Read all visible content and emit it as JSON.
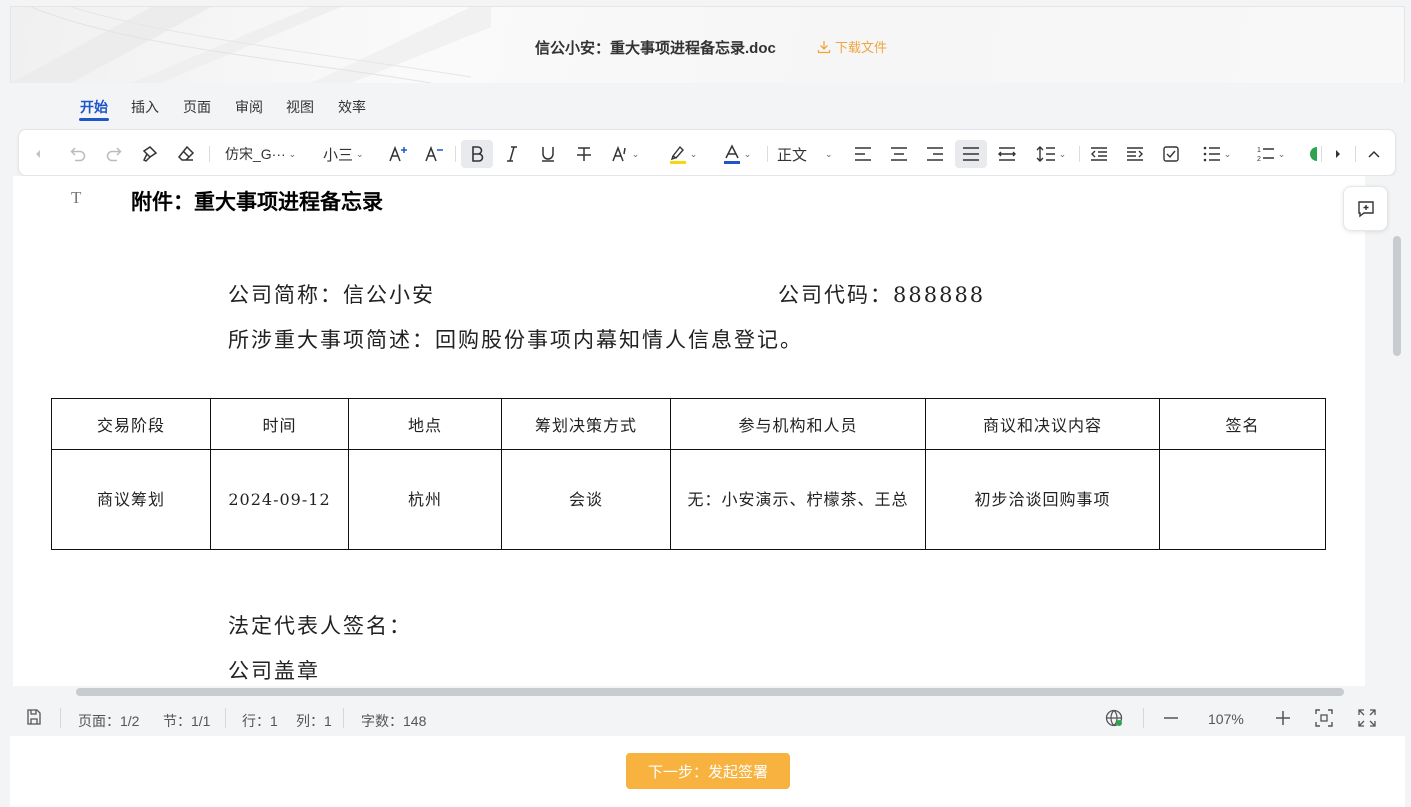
{
  "header": {
    "doc_title": "信公小安：重大事项进程备忘录.doc",
    "download_label": "下载文件"
  },
  "menu": {
    "tabs": [
      {
        "label": "开始",
        "active": true
      },
      {
        "label": "插入",
        "active": false
      },
      {
        "label": "页面",
        "active": false
      },
      {
        "label": "审阅",
        "active": false
      },
      {
        "label": "视图",
        "active": false
      },
      {
        "label": "效率",
        "active": false
      }
    ]
  },
  "toolbar": {
    "font_family": "仿宋_G···",
    "font_size": "小三",
    "style": "正文",
    "icons": [
      "prev-icon",
      "undo-icon",
      "redo-icon",
      "format-painter-icon",
      "eraser-icon",
      "font-grow-icon",
      "font-shrink-icon",
      "bold-icon",
      "italic-icon",
      "underline-icon",
      "strikethrough-icon",
      "text-effect-icon",
      "highlight-icon",
      "font-color-icon",
      "align-left-icon",
      "align-center-icon",
      "align-right-icon",
      "justify-icon",
      "distribute-icon",
      "line-spacing-icon",
      "indent-decrease-icon",
      "indent-increase-icon",
      "checkbox-list-icon",
      "bullet-list-icon",
      "numbered-list-icon",
      "next-icon",
      "collapse-icon"
    ],
    "colors": {
      "highlight": "#f5d90a",
      "font_color": "#1e56c9"
    }
  },
  "document": {
    "heading": "附件：重大事项进程备忘录",
    "company_short_label": "公司简称：信公小安",
    "company_code_label": "公司代码：888888",
    "matter_desc": "所涉重大事项简述：回购股份事项内幕知情人信息登记。",
    "table": {
      "headers": [
        "交易阶段",
        "时间",
        "地点",
        "筹划决策方式",
        "参与机构和人员",
        "商议和决议内容",
        "签名"
      ],
      "rows": [
        [
          "商议筹划",
          "2024-09-12",
          "杭州",
          "会谈",
          "无：小安演示、柠檬茶、王总",
          "初步洽谈回购事项",
          ""
        ]
      ]
    },
    "legal_rep_sign": "法定代表人签名：",
    "company_seal": "公司盖章"
  },
  "statusbar": {
    "page": "页面：1/2",
    "section": "节：1/1",
    "row": "行：1",
    "col": "列：1",
    "word_count": "字数：148",
    "zoom": "107%"
  },
  "footer": {
    "next_button": "下一步：发起签署"
  }
}
